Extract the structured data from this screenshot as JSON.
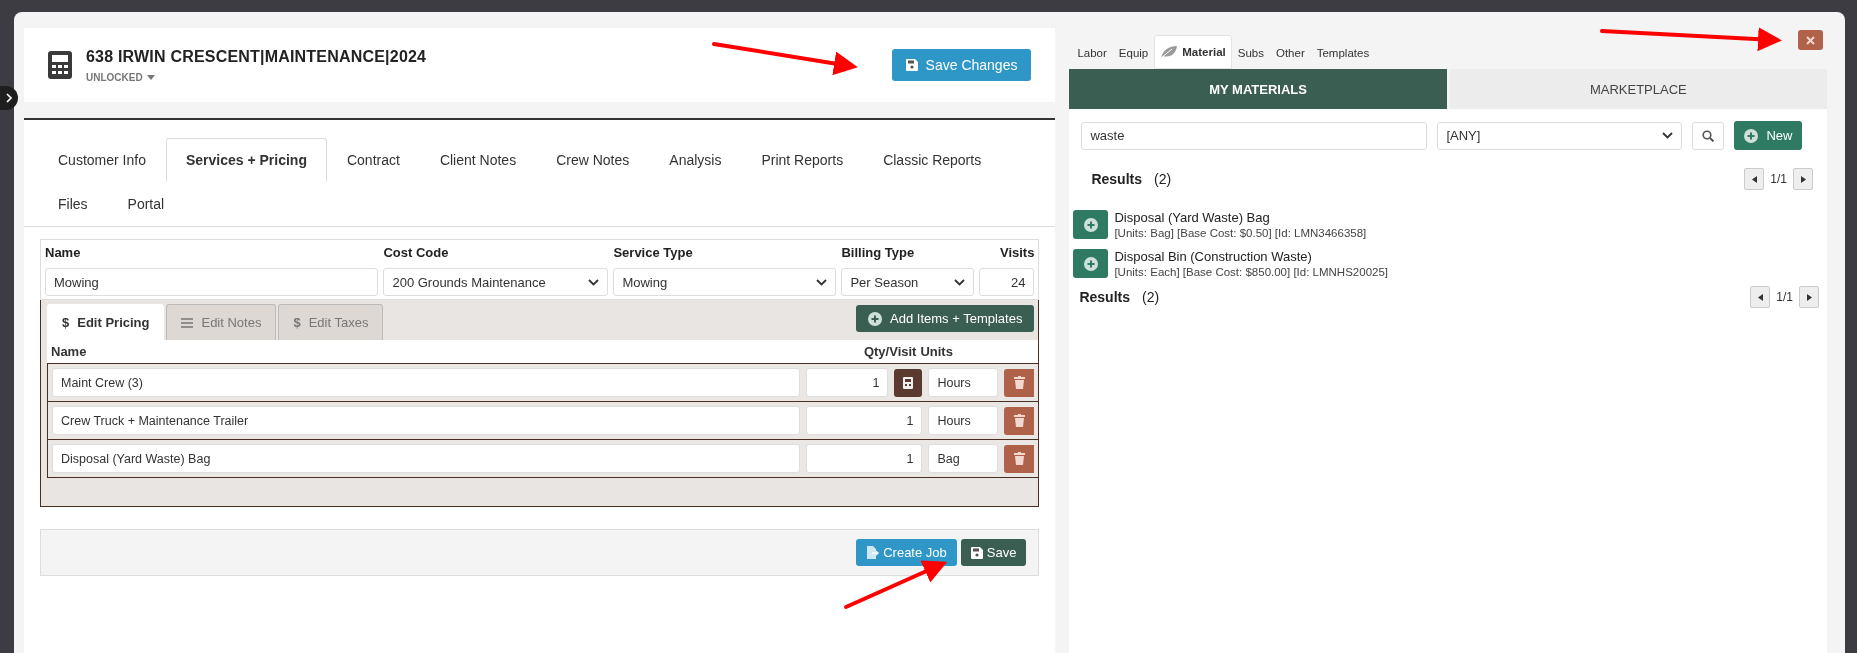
{
  "header": {
    "title": "638 IRWIN CRESCENT|MAINTENANCE|2024",
    "status": "UNLOCKED",
    "save_button": "Save Changes"
  },
  "tabs": [
    {
      "label": "Customer Info",
      "selected": false
    },
    {
      "label": "Services + Pricing",
      "selected": true
    },
    {
      "label": "Contract",
      "selected": false
    },
    {
      "label": "Client Notes",
      "selected": false
    },
    {
      "label": "Crew Notes",
      "selected": false
    },
    {
      "label": "Analysis",
      "selected": false
    },
    {
      "label": "Print Reports",
      "selected": false
    },
    {
      "label": "Classic Reports",
      "selected": false
    },
    {
      "label": "Files",
      "selected": false
    },
    {
      "label": "Portal",
      "selected": false
    }
  ],
  "service": {
    "columns": [
      "Name",
      "Cost Code",
      "Service Type",
      "Billing Type",
      "Visits"
    ],
    "name": "Mowing",
    "cost_code": "200 Grounds Maintenance",
    "service_type": "Mowing",
    "billing_type": "Per Season",
    "visits": "24"
  },
  "sub_tabs": [
    {
      "label": "Edit Pricing",
      "kind": "symbol",
      "symbol": "$",
      "selected": true
    },
    {
      "label": "Edit Notes",
      "kind": "list",
      "selected": false
    },
    {
      "label": "Edit Taxes",
      "kind": "symbol",
      "symbol": "$",
      "selected": false
    }
  ],
  "add_button": "Add Items + Templates",
  "item_columns": [
    "Name",
    "Qty/Visit",
    "Units"
  ],
  "items": [
    {
      "name": "Maint Crew (3)",
      "qty": "1",
      "units": "Hours",
      "calculator": true
    },
    {
      "name": "Crew Truck + Maintenance Trailer",
      "qty": "1",
      "units": "Hours",
      "calculator": false
    },
    {
      "name": "Disposal (Yard Waste) Bag",
      "qty": "1",
      "units": "Bag",
      "calculator": false
    }
  ],
  "footer_buttons": [
    {
      "label": "Create Job",
      "kind": "create"
    },
    {
      "label": "Save",
      "kind": "save"
    }
  ],
  "right": {
    "category_tabs": [
      {
        "label": "Labor",
        "selected": false
      },
      {
        "label": "Equip",
        "selected": false
      },
      {
        "label": "Material",
        "selected": true
      },
      {
        "label": "Subs",
        "selected": false
      },
      {
        "label": "Other",
        "selected": false
      },
      {
        "label": "Templates",
        "selected": false
      }
    ],
    "segments": [
      {
        "label": "MY MATERIALS",
        "selected": true
      },
      {
        "label": "MARKETPLACE",
        "selected": false
      }
    ],
    "search": "waste",
    "filter": "[ANY]",
    "new_button": "New",
    "results_label": "Results",
    "results_count": "(2)",
    "pages": "1/1",
    "results": [
      {
        "name": "Disposal (Yard Waste) Bag",
        "details": "[Units: Bag] [Base Cost: $0.50] [Id: LMN3466358]"
      },
      {
        "name": "Disposal Bin (Construction Waste)",
        "details": "[Units: Each] [Base Cost: $850.00] [Id: LMNHS20025]"
      }
    ],
    "results_label_bottom": "Results",
    "results_count_bottom": "(2)",
    "pages_bottom": "1/1"
  }
}
